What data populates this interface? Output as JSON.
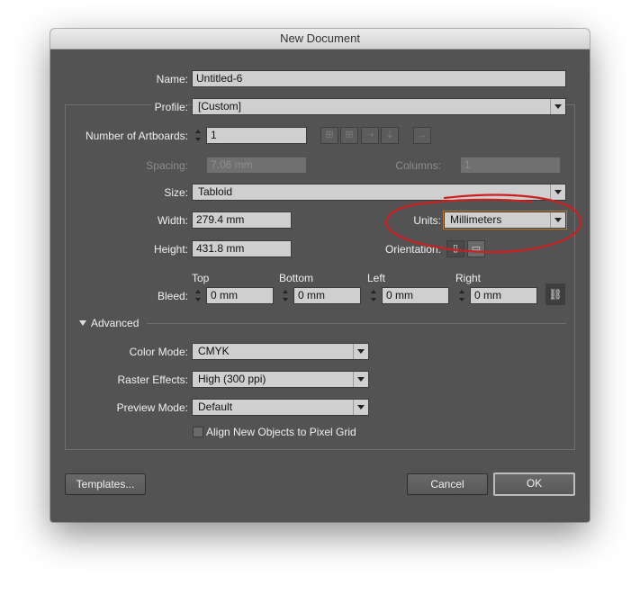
{
  "window": {
    "title": "New Document"
  },
  "name": {
    "label": "Name:",
    "value": "Untitled-6"
  },
  "profile": {
    "label": "Profile:",
    "value": "[Custom]"
  },
  "artboards": {
    "label": "Number of Artboards:",
    "value": "1"
  },
  "spacing": {
    "label": "Spacing:",
    "value": "7.06 mm"
  },
  "columns": {
    "label": "Columns:",
    "value": "1"
  },
  "size": {
    "label": "Size:",
    "value": "Tabloid"
  },
  "width": {
    "label": "Width:",
    "value": "279.4 mm"
  },
  "height": {
    "label": "Height:",
    "value": "431.8 mm"
  },
  "units": {
    "label": "Units:",
    "value": "Millimeters",
    "annotation_color": "#cc1f1f"
  },
  "orientation": {
    "label": "Orientation:"
  },
  "bleed": {
    "label": "Bleed:",
    "fields": [
      {
        "label": "Top",
        "value": "0 mm"
      },
      {
        "label": "Bottom",
        "value": "0 mm"
      },
      {
        "label": "Left",
        "value": "0 mm"
      },
      {
        "label": "Right",
        "value": "0 mm"
      }
    ]
  },
  "advanced": {
    "label": "Advanced",
    "color_mode": {
      "label": "Color Mode:",
      "value": "CMYK"
    },
    "raster_effects": {
      "label": "Raster Effects:",
      "value": "High (300 ppi)"
    },
    "preview_mode": {
      "label": "Preview Mode:",
      "value": "Default"
    },
    "align_pixel_grid": {
      "label": "Align New Objects to Pixel Grid",
      "checked": false
    }
  },
  "buttons": {
    "templates": "Templates...",
    "cancel": "Cancel",
    "ok": "OK"
  },
  "icons": [
    "grid-by-row-icon",
    "grid-by-column-icon",
    "arrange-by-row-icon",
    "arrange-by-column-icon",
    "right-to-left-icon",
    "portrait-icon",
    "landscape-icon",
    "link-bleed-icon"
  ]
}
